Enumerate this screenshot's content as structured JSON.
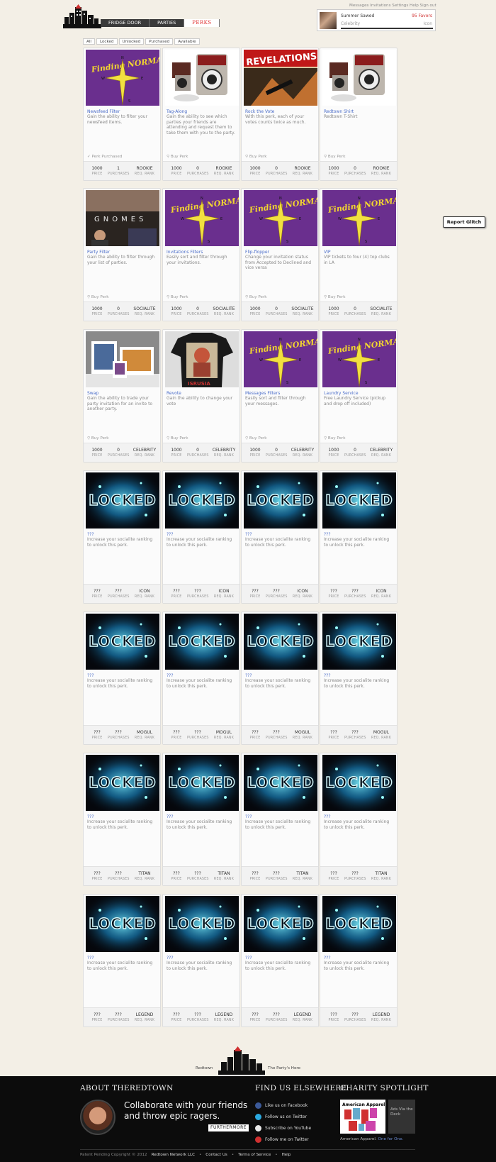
{
  "nav": {
    "tabs": [
      "FRIDGE DOOR",
      "PARTIES",
      "PERKS"
    ]
  },
  "toplinks": "Messages Invitations Settings Help Sign out",
  "profile": {
    "name": "Summer Sawed",
    "favors": "95 Favors",
    "rank": "Celebrity",
    "next_rank": "Icon"
  },
  "filters": [
    "All",
    "Locked",
    "Unlocked",
    "Purchased",
    "Available"
  ],
  "stat_labels": {
    "price": "PRICE",
    "purchases": "PURCHASES",
    "rank": "REQ. RANK"
  },
  "perks": [
    {
      "img": "finding-normal",
      "title": "Newsfeed Filter",
      "desc": "Gain the ability to filter your newsfeed items.",
      "status": "✓ Perk Purchased",
      "price": "1000",
      "purchases": "1",
      "rank": "ROOKIE"
    },
    {
      "img": "camera",
      "title": "Tag-Along",
      "desc": "Gain the ability to see which parties your friends are attending and request them to take them with you to the party.",
      "status": "Buy Perk",
      "price": "1000",
      "purchases": "0",
      "rank": "ROOKIE"
    },
    {
      "img": "revelations",
      "title": "Rock the Vote",
      "desc": "With this perk, each of your votes counts twice as much.",
      "status": "Buy Perk",
      "price": "1000",
      "purchases": "0",
      "rank": "ROOKIE"
    },
    {
      "img": "camera",
      "title": "Redtown Shirt",
      "desc": "Redtown T-Shirt",
      "status": "Buy Perk",
      "price": "1000",
      "purchases": "0",
      "rank": "ROOKIE"
    },
    {
      "img": "gnomes",
      "title": "Party Filter",
      "desc": "Gain the ability to filter through your list of parties.",
      "status": "Buy Perk",
      "price": "1000",
      "purchases": "0",
      "rank": "SOCIALITE"
    },
    {
      "img": "finding-normal",
      "title": "Invitations Filters",
      "desc": "Easily sort and filter through your invitations.",
      "status": "Buy Perk",
      "price": "1000",
      "purchases": "0",
      "rank": "SOCIALITE"
    },
    {
      "img": "finding-normal",
      "title": "Flip-flopper",
      "desc": "Change your invitation status from Accepted to Declined and vice versa",
      "status": "Buy Perk",
      "price": "1000",
      "purchases": "0",
      "rank": "SOCIALITE"
    },
    {
      "img": "finding-normal",
      "title": "VIP",
      "desc": "VIP tickets to four (4) top clubs in LA",
      "status": "Buy Perk",
      "price": "1000",
      "purchases": "0",
      "rank": "SOCIALITE"
    },
    {
      "img": "frames",
      "title": "Swap",
      "desc": "Gain the ability to trade your party invitation for an invite to another party.",
      "status": "Buy Perk",
      "price": "1000",
      "purchases": "0",
      "rank": "CELEBRITY"
    },
    {
      "img": "tshirt",
      "title": "Revote",
      "desc": "Gain the ability to change your vote",
      "status": "Buy Perk",
      "price": "1000",
      "purchases": "0",
      "rank": "CELEBRITY"
    },
    {
      "img": "finding-normal",
      "title": "Messages Filters",
      "desc": "Easily sort and filter through your messages.",
      "status": "Buy Perk",
      "price": "1000",
      "purchases": "0",
      "rank": "CELEBRITY"
    },
    {
      "img": "finding-normal",
      "title": "Laundry Service",
      "desc": "Free Laundry Service (pickup and drop off included)",
      "status": "Buy Perk",
      "price": "1000",
      "purchases": "0",
      "rank": "CELEBRITY"
    },
    {
      "img": "locked",
      "title": "???",
      "desc": "Increase your socialite ranking to unlock this perk.",
      "status": "",
      "price": "???",
      "purchases": "???",
      "rank": "ICON"
    },
    {
      "img": "locked",
      "title": "???",
      "desc": "Increase your socialite ranking to unlock this perk.",
      "status": "",
      "price": "???",
      "purchases": "???",
      "rank": "ICON"
    },
    {
      "img": "locked",
      "title": "???",
      "desc": "Increase your socialite ranking to unlock this perk.",
      "status": "",
      "price": "???",
      "purchases": "???",
      "rank": "ICON"
    },
    {
      "img": "locked",
      "title": "???",
      "desc": "Increase your socialite ranking to unlock this perk.",
      "status": "",
      "price": "???",
      "purchases": "???",
      "rank": "ICON"
    },
    {
      "img": "locked",
      "title": "???",
      "desc": "Increase your socialite ranking to unlock this perk.",
      "status": "",
      "price": "???",
      "purchases": "???",
      "rank": "MOGUL"
    },
    {
      "img": "locked",
      "title": "???",
      "desc": "Increase your socialite ranking to unlock this perk.",
      "status": "",
      "price": "???",
      "purchases": "???",
      "rank": "MOGUL"
    },
    {
      "img": "locked",
      "title": "???",
      "desc": "Increase your socialite ranking to unlock this perk.",
      "status": "",
      "price": "???",
      "purchases": "???",
      "rank": "MOGUL"
    },
    {
      "img": "locked",
      "title": "???",
      "desc": "Increase your socialite ranking to unlock this perk.",
      "status": "",
      "price": "???",
      "purchases": "???",
      "rank": "MOGUL"
    },
    {
      "img": "locked",
      "title": "???",
      "desc": "Increase your socialite ranking to unlock this perk.",
      "status": "",
      "price": "???",
      "purchases": "???",
      "rank": "TITAN"
    },
    {
      "img": "locked",
      "title": "???",
      "desc": "Increase your socialite ranking to unlock this perk.",
      "status": "",
      "price": "???",
      "purchases": "???",
      "rank": "TITAN"
    },
    {
      "img": "locked",
      "title": "???",
      "desc": "Increase your socialite ranking to unlock this perk.",
      "status": "",
      "price": "???",
      "purchases": "???",
      "rank": "TITAN"
    },
    {
      "img": "locked",
      "title": "???",
      "desc": "Increase your socialite ranking to unlock this perk.",
      "status": "",
      "price": "???",
      "purchases": "???",
      "rank": "TITAN"
    },
    {
      "img": "locked",
      "title": "???",
      "desc": "Increase your socialite ranking to unlock this perk.",
      "status": "",
      "price": "???",
      "purchases": "???",
      "rank": "LEGEND"
    },
    {
      "img": "locked",
      "title": "???",
      "desc": "Increase your socialite ranking to unlock this perk.",
      "status": "",
      "price": "???",
      "purchases": "???",
      "rank": "LEGEND"
    },
    {
      "img": "locked",
      "title": "???",
      "desc": "Increase your socialite ranking to unlock this perk.",
      "status": "",
      "price": "???",
      "purchases": "???",
      "rank": "LEGEND"
    },
    {
      "img": "locked",
      "title": "???",
      "desc": "Increase your socialite ranking to unlock this perk.",
      "status": "",
      "price": "???",
      "purchases": "???",
      "rank": "LEGEND"
    }
  ],
  "image_text": {
    "finding_normal": "Finding NORMAL",
    "revelations": "REVELATIONS",
    "gnomes": "GNOMES",
    "locked": "LOCKED",
    "tshirt": "ISRUSIA",
    "compass": [
      "N",
      "W",
      "E",
      "S"
    ]
  },
  "report_glitch": "Report Glitch",
  "bottom_logo": {
    "left": "Redtown",
    "right": "The Party's Here"
  },
  "footer": {
    "about_title": "ABOUT THEREDTOWN",
    "tagline": "Collaborate with your friends and throw epic ragers.",
    "more": "FURTHERMORE",
    "find_title": "FIND US ELSEWHERE",
    "social": [
      {
        "label": "Like us on Facebook",
        "icon": "facebook-icon",
        "color": "#3b5998"
      },
      {
        "label": "Follow us on Twitter",
        "icon": "twitter-icon",
        "color": "#2aa9e0"
      },
      {
        "label": "Subscribe on YouTube",
        "icon": "youtube-icon",
        "color": "#e8e8e8"
      },
      {
        "label": "Follow me on Twitter",
        "icon": "x-icon",
        "color": "#d03030"
      }
    ],
    "charity_title": "CHARITY SPOTLIGHT",
    "charity_brand": "American Apparel",
    "charity_ads": "Ads Via the Deck",
    "charity_caption": "American Apparel.",
    "charity_caption_link": "One for One.",
    "copyright": "Patent Pending Copyright © 2012",
    "company": "Redtown Network LLC",
    "links": [
      "Contact Us",
      "Terms of Service",
      "Help"
    ]
  },
  "colors": {
    "accent": "#4a6cc8",
    "brand_red": "#e03030",
    "page_bg": "#f3efe6",
    "footer_bg": "#0c0c0c"
  }
}
